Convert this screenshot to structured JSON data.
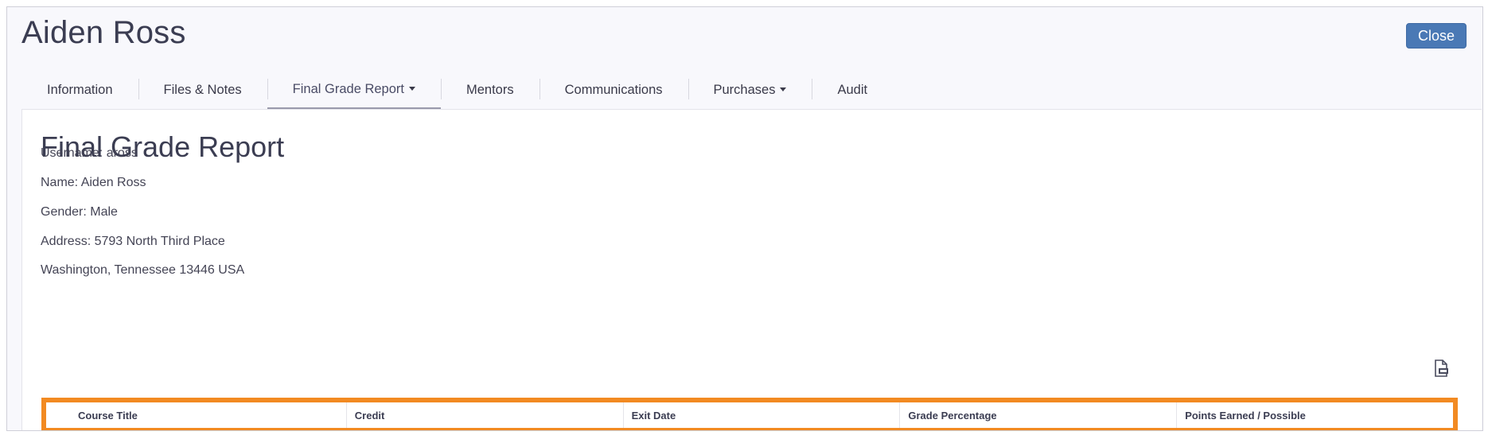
{
  "header": {
    "student_name": "Aiden Ross",
    "close_label": "Close"
  },
  "tabs": [
    {
      "label": "Information"
    },
    {
      "label": "Files & Notes"
    },
    {
      "label": "Final Grade Report"
    },
    {
      "label": "Mentors"
    },
    {
      "label": "Communications"
    },
    {
      "label": "Purchases"
    },
    {
      "label": "Audit"
    }
  ],
  "active_tab": "Final Grade Report",
  "report": {
    "title": "Final Grade Report",
    "username": "Username: aross",
    "name": "Name: Aiden Ross",
    "gender": "Gender: Male",
    "address": "Address: 5793 North Third Place",
    "city_line": "Washington, Tennessee 13446 USA"
  },
  "table": {
    "columns": [
      "Course Title",
      "Credit",
      "Exit Date",
      "Grade Percentage",
      "Points Earned / Possible"
    ]
  },
  "icons": {
    "export": "export-file-icon"
  },
  "colors": {
    "accent": "#4a79b5",
    "highlight": "#f28a22"
  }
}
